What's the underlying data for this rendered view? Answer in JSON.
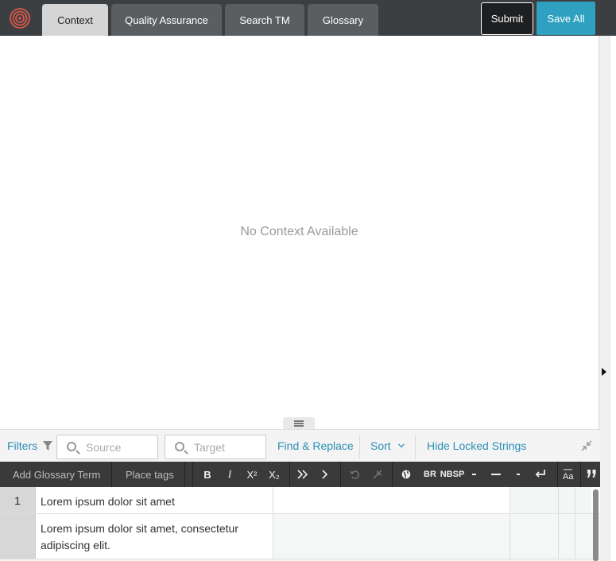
{
  "colors": {
    "topbar": "#3c3f41",
    "accent": "#2fa0c0",
    "link": "#2a8fb5",
    "brand_logo": "#d9574a"
  },
  "header": {
    "tabs": [
      {
        "label": "Context",
        "active": true
      },
      {
        "label": "Quality Assurance",
        "active": false
      },
      {
        "label": "Search TM",
        "active": false
      },
      {
        "label": "Glossary",
        "active": false
      }
    ],
    "submit_label": "Submit",
    "save_all_label": "Save All"
  },
  "context": {
    "empty_message": "No Context Available"
  },
  "filters": {
    "filters_label": "Filters",
    "source_placeholder": "Source",
    "target_placeholder": "Target",
    "find_replace_label": "Find & Replace",
    "sort_label": "Sort",
    "hide_locked_label": "Hide Locked Strings"
  },
  "toolbar": {
    "add_glossary_label": "Add Glossary Term",
    "place_tags_label": "Place tags",
    "bold": "B",
    "italic": "I",
    "superscript": "X²",
    "subscript": "X₂",
    "br": "BR",
    "nbsp": "NBSP"
  },
  "rows": [
    {
      "number": "1",
      "source": "Lorem ipsum dolor sit amet",
      "target": ""
    },
    {
      "number": "",
      "source": "Lorem ipsum dolor sit amet, consectetur adipiscing elit.",
      "target": ""
    }
  ]
}
